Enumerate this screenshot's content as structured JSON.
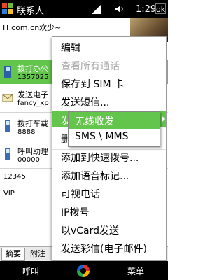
{
  "status_bar": {
    "title": "联系人",
    "time": "1:29",
    "close": "ok"
  },
  "header": {
    "greeting": "IT.com.cn欢少~"
  },
  "contacts": [
    {
      "name": "拨打办公",
      "sub": "1357025"
    },
    {
      "name": "发送电子",
      "sub": "fancy_xp"
    },
    {
      "name": "拨打车载",
      "sub": "8888"
    },
    {
      "name": "呼叫助理",
      "sub": "00000"
    }
  ],
  "plain_rows": [
    "12345",
    "VIP"
  ],
  "tabs": [
    "摘要",
    "附注"
  ],
  "softkeys": {
    "left": "呼叫",
    "right": "菜单"
  },
  "menu": {
    "items": [
      {
        "label": "编辑",
        "enabled": true
      },
      {
        "label": "查看所有通话",
        "enabled": false
      },
      {
        "label": "保存到 SIM 卡",
        "enabled": true
      },
      {
        "label": "发送短信...",
        "enabled": true
      },
      {
        "label": "发送",
        "enabled": true,
        "highlighted": true,
        "submenu": true
      },
      {
        "label": "删除",
        "enabled": true
      },
      {
        "label": "添加到快速拨号...",
        "enabled": true
      },
      {
        "label": "添加语音标记...",
        "enabled": true
      },
      {
        "label": "可视电话",
        "enabled": true
      },
      {
        "label": "IP拨号",
        "enabled": true
      },
      {
        "label": "以vCard发送",
        "enabled": true
      },
      {
        "label": "发送彩信(电子邮件)",
        "enabled": true
      }
    ]
  },
  "submenu": {
    "items": [
      {
        "label": "无线收发",
        "highlighted": true
      },
      {
        "label": "SMS \\ MMS",
        "highlighted": false
      }
    ]
  },
  "colors": {
    "highlight": "#63c54c"
  }
}
